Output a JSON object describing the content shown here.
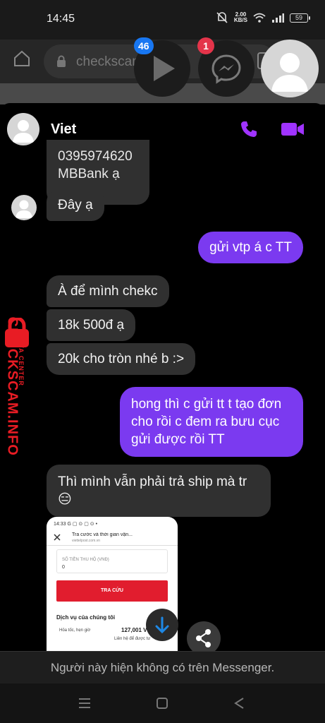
{
  "status_bar": {
    "time": "14:45",
    "speed_value": "2.00",
    "speed_unit": "KB/S",
    "battery": "59"
  },
  "browser": {
    "url": "checkscam.info"
  },
  "chat_heads": {
    "play_badge": "46",
    "messenger_badge": "1"
  },
  "chat": {
    "contact_name": "Viet",
    "messages": [
      {
        "from": "them",
        "text": "0395974620\nMBBank ạ"
      },
      {
        "from": "them",
        "text": "Đây ạ"
      },
      {
        "from": "me",
        "text": "gửi vtp á c TT"
      },
      {
        "from": "them",
        "text": "À để mình chekc"
      },
      {
        "from": "them",
        "text": "18k 500đ ạ"
      },
      {
        "from": "them",
        "text": "20k cho tròn nhé b :>"
      },
      {
        "from": "me",
        "text": "hong thì c gửi tt t tạo đơn cho rồi c đem ra bưu cục gửi được rồi TT"
      },
      {
        "from": "them",
        "text": "Thì mình vẫn phải trả ship mà tr 😑"
      }
    ],
    "attachment": {
      "status": "14:33 G ▢ ⊙ ▢ ⊙ •",
      "title": "Tra cước và thời gian vận...",
      "url": "viettelpost.com.vn",
      "field_label": "SỐ TIỀN THU HỘ (VNĐ)",
      "field_value": "0",
      "button": "TRA CỨU",
      "section": "Dịch vụ của chúng tôi",
      "row_label": "Hỏa tốc, hẹn giờ",
      "row_price": "127,001 V",
      "row_contact": "Liên hệ để được tư"
    },
    "notice": "Người này hiện không có trên Messenger."
  },
  "watermark": {
    "main": "CHECKSCAM.INFO",
    "sub": "DATA CENTER"
  },
  "colors": {
    "outgoing": "#7b3af0",
    "incoming": "#303030",
    "accent": "#a033ff",
    "watermark": "#e81c24"
  },
  "icons": [
    "home-icon",
    "lock-icon",
    "play-icon",
    "messenger-icon",
    "phone-icon",
    "video-icon",
    "arrow-down-icon",
    "share-icon",
    "menu-icon",
    "square-icon",
    "back-icon"
  ]
}
